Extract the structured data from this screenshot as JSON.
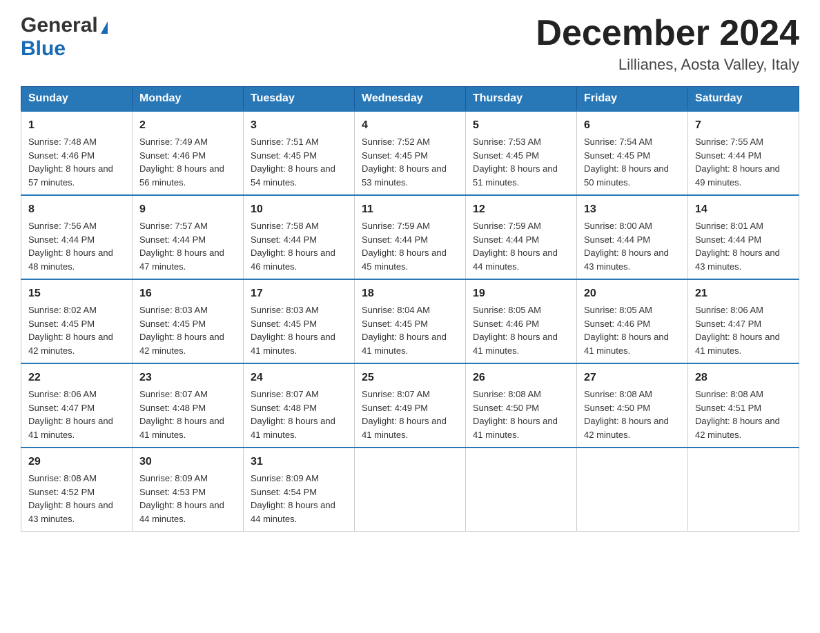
{
  "header": {
    "logo_general": "General",
    "logo_blue": "Blue",
    "month_title": "December 2024",
    "location": "Lillianes, Aosta Valley, Italy"
  },
  "days_of_week": [
    "Sunday",
    "Monday",
    "Tuesday",
    "Wednesday",
    "Thursday",
    "Friday",
    "Saturday"
  ],
  "weeks": [
    [
      {
        "day": 1,
        "sunrise": "7:48 AM",
        "sunset": "4:46 PM",
        "daylight": "8 hours and 57 minutes."
      },
      {
        "day": 2,
        "sunrise": "7:49 AM",
        "sunset": "4:46 PM",
        "daylight": "8 hours and 56 minutes."
      },
      {
        "day": 3,
        "sunrise": "7:51 AM",
        "sunset": "4:45 PM",
        "daylight": "8 hours and 54 minutes."
      },
      {
        "day": 4,
        "sunrise": "7:52 AM",
        "sunset": "4:45 PM",
        "daylight": "8 hours and 53 minutes."
      },
      {
        "day": 5,
        "sunrise": "7:53 AM",
        "sunset": "4:45 PM",
        "daylight": "8 hours and 51 minutes."
      },
      {
        "day": 6,
        "sunrise": "7:54 AM",
        "sunset": "4:45 PM",
        "daylight": "8 hours and 50 minutes."
      },
      {
        "day": 7,
        "sunrise": "7:55 AM",
        "sunset": "4:44 PM",
        "daylight": "8 hours and 49 minutes."
      }
    ],
    [
      {
        "day": 8,
        "sunrise": "7:56 AM",
        "sunset": "4:44 PM",
        "daylight": "8 hours and 48 minutes."
      },
      {
        "day": 9,
        "sunrise": "7:57 AM",
        "sunset": "4:44 PM",
        "daylight": "8 hours and 47 minutes."
      },
      {
        "day": 10,
        "sunrise": "7:58 AM",
        "sunset": "4:44 PM",
        "daylight": "8 hours and 46 minutes."
      },
      {
        "day": 11,
        "sunrise": "7:59 AM",
        "sunset": "4:44 PM",
        "daylight": "8 hours and 45 minutes."
      },
      {
        "day": 12,
        "sunrise": "7:59 AM",
        "sunset": "4:44 PM",
        "daylight": "8 hours and 44 minutes."
      },
      {
        "day": 13,
        "sunrise": "8:00 AM",
        "sunset": "4:44 PM",
        "daylight": "8 hours and 43 minutes."
      },
      {
        "day": 14,
        "sunrise": "8:01 AM",
        "sunset": "4:44 PM",
        "daylight": "8 hours and 43 minutes."
      }
    ],
    [
      {
        "day": 15,
        "sunrise": "8:02 AM",
        "sunset": "4:45 PM",
        "daylight": "8 hours and 42 minutes."
      },
      {
        "day": 16,
        "sunrise": "8:03 AM",
        "sunset": "4:45 PM",
        "daylight": "8 hours and 42 minutes."
      },
      {
        "day": 17,
        "sunrise": "8:03 AM",
        "sunset": "4:45 PM",
        "daylight": "8 hours and 41 minutes."
      },
      {
        "day": 18,
        "sunrise": "8:04 AM",
        "sunset": "4:45 PM",
        "daylight": "8 hours and 41 minutes."
      },
      {
        "day": 19,
        "sunrise": "8:05 AM",
        "sunset": "4:46 PM",
        "daylight": "8 hours and 41 minutes."
      },
      {
        "day": 20,
        "sunrise": "8:05 AM",
        "sunset": "4:46 PM",
        "daylight": "8 hours and 41 minutes."
      },
      {
        "day": 21,
        "sunrise": "8:06 AM",
        "sunset": "4:47 PM",
        "daylight": "8 hours and 41 minutes."
      }
    ],
    [
      {
        "day": 22,
        "sunrise": "8:06 AM",
        "sunset": "4:47 PM",
        "daylight": "8 hours and 41 minutes."
      },
      {
        "day": 23,
        "sunrise": "8:07 AM",
        "sunset": "4:48 PM",
        "daylight": "8 hours and 41 minutes."
      },
      {
        "day": 24,
        "sunrise": "8:07 AM",
        "sunset": "4:48 PM",
        "daylight": "8 hours and 41 minutes."
      },
      {
        "day": 25,
        "sunrise": "8:07 AM",
        "sunset": "4:49 PM",
        "daylight": "8 hours and 41 minutes."
      },
      {
        "day": 26,
        "sunrise": "8:08 AM",
        "sunset": "4:50 PM",
        "daylight": "8 hours and 41 minutes."
      },
      {
        "day": 27,
        "sunrise": "8:08 AM",
        "sunset": "4:50 PM",
        "daylight": "8 hours and 42 minutes."
      },
      {
        "day": 28,
        "sunrise": "8:08 AM",
        "sunset": "4:51 PM",
        "daylight": "8 hours and 42 minutes."
      }
    ],
    [
      {
        "day": 29,
        "sunrise": "8:08 AM",
        "sunset": "4:52 PM",
        "daylight": "8 hours and 43 minutes."
      },
      {
        "day": 30,
        "sunrise": "8:09 AM",
        "sunset": "4:53 PM",
        "daylight": "8 hours and 44 minutes."
      },
      {
        "day": 31,
        "sunrise": "8:09 AM",
        "sunset": "4:54 PM",
        "daylight": "8 hours and 44 minutes."
      },
      null,
      null,
      null,
      null
    ]
  ]
}
